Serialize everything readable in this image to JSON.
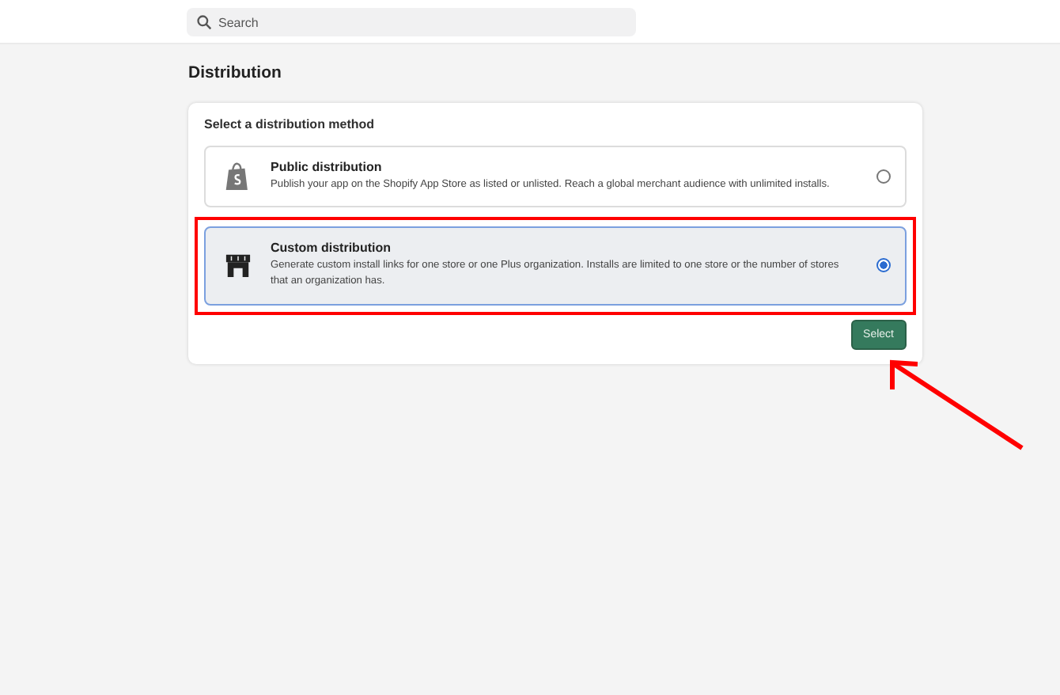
{
  "search": {
    "placeholder": "Search"
  },
  "page": {
    "title": "Distribution"
  },
  "card": {
    "title": "Select a distribution method",
    "options": [
      {
        "kind": "public",
        "title": "Public distribution",
        "description": "Publish your app on the Shopify App Store as listed or unlisted. Reach a global merchant audience with unlimited installs.",
        "selected": false,
        "highlighted": false
      },
      {
        "kind": "custom",
        "title": "Custom distribution",
        "description": "Generate custom install links for one store or one Plus organization. Installs are limited to one store or the number of stores that an organization has.",
        "selected": true,
        "highlighted": true
      }
    ],
    "button": "Select"
  }
}
